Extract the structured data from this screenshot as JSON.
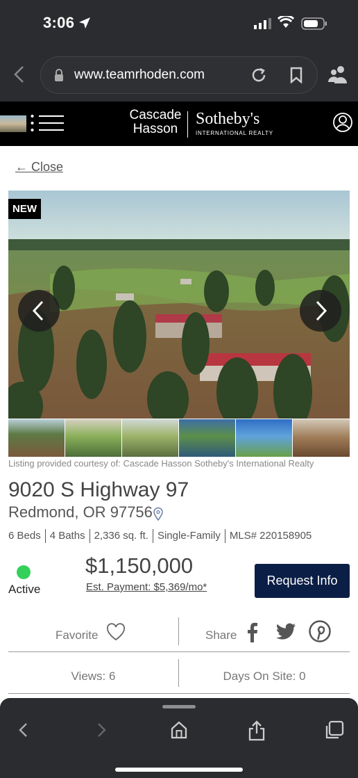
{
  "status_bar": {
    "time": "3:06"
  },
  "browser": {
    "url": "www.teamrhoden.com"
  },
  "site_header": {
    "logo_line1": "Cascade",
    "logo_line2": "Hasson",
    "logo_brand": "Sotheby's",
    "logo_sub": "INTERNATIONAL REALTY"
  },
  "listing": {
    "close_label": "← Close",
    "badge": "NEW",
    "courtesy": "Listing provided courtesy of: Cascade Hasson Sotheby's International Realty",
    "address": "9020 S Highway 97",
    "city_state_zip": "Redmond, OR 97756",
    "specs": [
      "6 Beds",
      "4 Baths",
      "2,336 sq. ft.",
      "Single-Family",
      "MLS# 220158905"
    ],
    "status": "Active",
    "status_color": "#34d15a",
    "price": "$1,150,000",
    "est_payment": "Est. Payment: $5,369/mo*",
    "request_button": "Request Info",
    "favorite_label": "Favorite",
    "share_label": "Share",
    "views": "Views: 6",
    "days_on_site": "Days On Site: 0"
  },
  "colors": {
    "brand_navy": "#0b1e45",
    "chrome": "#2b2c2f"
  },
  "icons": [
    "location-arrow-icon",
    "signal-icon",
    "wifi-icon",
    "battery-icon",
    "back-icon",
    "lock-icon",
    "reload-icon",
    "bookmark-icon",
    "reader-icon",
    "menu-icon",
    "account-icon",
    "chevron-left-icon",
    "chevron-right-icon",
    "map-pin-icon",
    "heart-icon",
    "facebook-icon",
    "twitter-icon",
    "pinterest-icon",
    "share-icon",
    "home-icon",
    "tabs-icon"
  ]
}
